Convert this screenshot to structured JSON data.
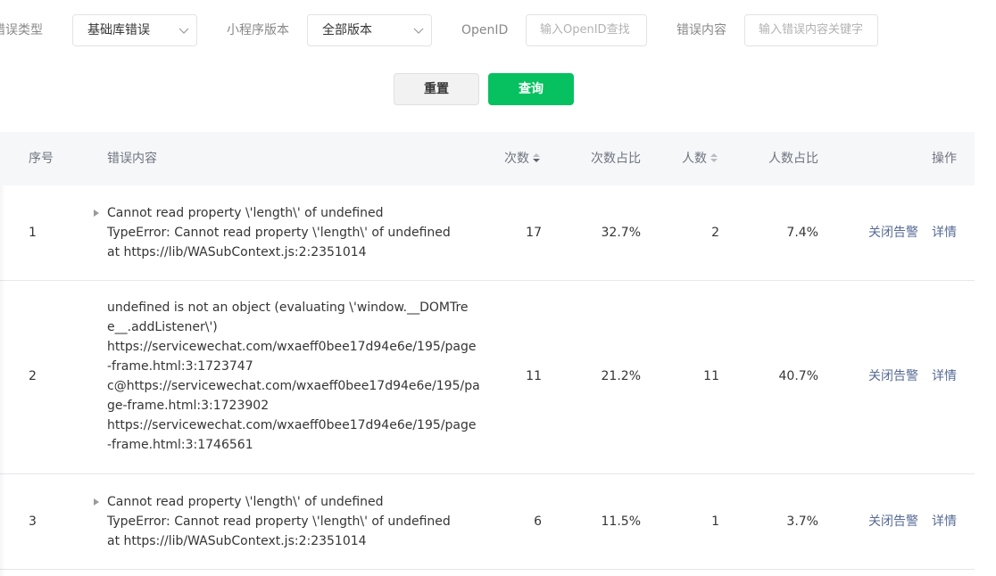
{
  "filters": {
    "error_type": {
      "label": "错误类型",
      "value": "基础库错误"
    },
    "version": {
      "label": "小程序版本",
      "value": "全部版本"
    },
    "openid": {
      "label": "OpenID",
      "placeholder": "输入OpenID查找"
    },
    "content": {
      "label": "错误内容",
      "placeholder": "输入错误内容关键字"
    }
  },
  "actions": {
    "reset_label": "重置",
    "query_label": "查询"
  },
  "table": {
    "headers": {
      "index": "序号",
      "content": "错误内容",
      "count": "次数",
      "count_ratio": "次数占比",
      "users": "人数",
      "users_ratio": "人数占比",
      "ops": "操作"
    },
    "rows": [
      {
        "index": "1",
        "lines": [
          "Cannot read property \\'length\\' of undefined",
          "TypeError: Cannot read property \\'length\\' of undefined",
          "at https://lib/WASubContext.js:2:2351014"
        ],
        "count": "17",
        "count_ratio": "32.7%",
        "users": "2",
        "users_ratio": "7.4%",
        "close_alert": "关闭告警",
        "detail": "详情"
      },
      {
        "index": "2",
        "lines": [
          "undefined is not an object (evaluating \\'window.__DOMTre",
          "e__.addListener\\')",
          "https://servicewechat.com/wxaeff0bee17d94e6e/195/page",
          "-frame.html:3:1723747",
          "c@https://servicewechat.com/wxaeff0bee17d94e6e/195/pa",
          "ge-frame.html:3:1723902",
          "https://servicewechat.com/wxaeff0bee17d94e6e/195/page",
          "-frame.html:3:1746561"
        ],
        "count": "11",
        "count_ratio": "21.2%",
        "users": "11",
        "users_ratio": "40.7%",
        "close_alert": "关闭告警",
        "detail": "详情"
      },
      {
        "index": "3",
        "lines": [
          "Cannot read property \\'length\\' of undefined",
          "TypeError: Cannot read property \\'length\\' of undefined",
          "at https://lib/WASubContext.js:2:2351014"
        ],
        "count": "6",
        "count_ratio": "11.5%",
        "users": "1",
        "users_ratio": "3.7%",
        "close_alert": "关闭告警",
        "detail": "详情"
      }
    ]
  },
  "icons": {
    "chevron": "chevron-down-icon",
    "sort": "sort-icon",
    "expand": "caret-right-icon"
  },
  "colors": {
    "primary": "#07c160",
    "link": "#576b95",
    "header_bg": "#f6f7f9"
  }
}
